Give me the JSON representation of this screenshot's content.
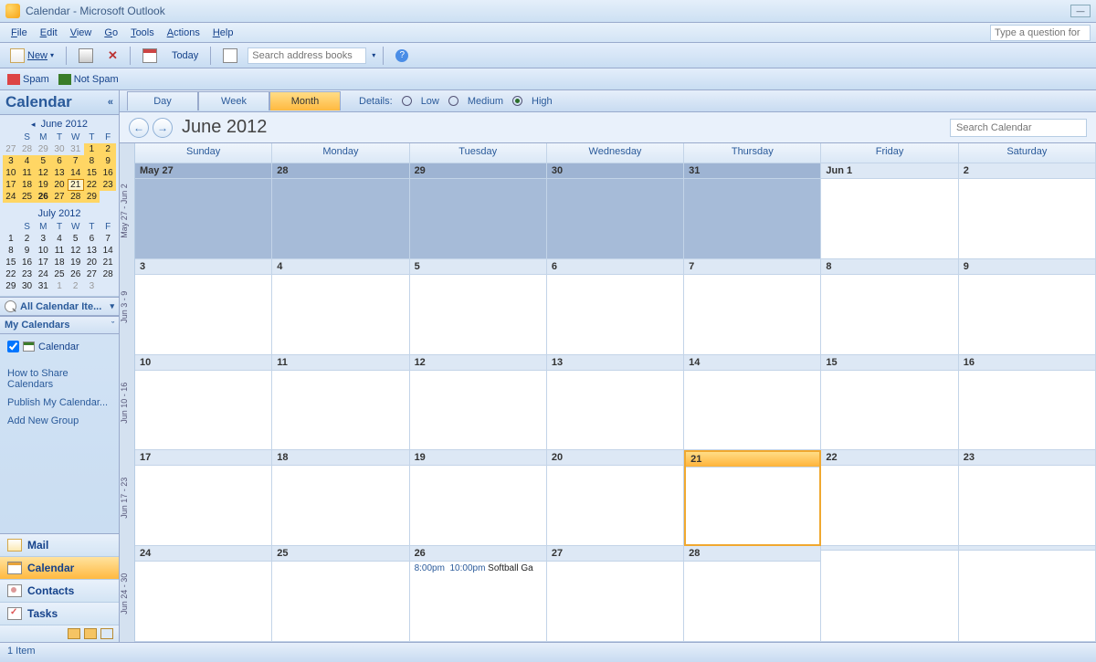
{
  "titlebar": {
    "title": "Calendar - Microsoft Outlook"
  },
  "menu": [
    "File",
    "Edit",
    "View",
    "Go",
    "Tools",
    "Actions",
    "Help"
  ],
  "help_placeholder": "Type a question for",
  "toolbar": {
    "new": "New",
    "today": "Today",
    "search_placeholder": "Search address books"
  },
  "spam": {
    "spam": "Spam",
    "notspam": "Not Spam"
  },
  "leftnav": {
    "header": "Calendar",
    "month1": {
      "title": "June 2012",
      "dow": [
        "S",
        "M",
        "T",
        "W",
        "T",
        "F"
      ],
      "weeks": [
        [
          {
            "n": "27",
            "c": "off"
          },
          {
            "n": "28",
            "c": "off"
          },
          {
            "n": "29",
            "c": "off"
          },
          {
            "n": "30",
            "c": "off"
          },
          {
            "n": "31",
            "c": "off"
          },
          {
            "n": "1",
            "c": "cur"
          },
          {
            "n": "2",
            "c": "cur"
          }
        ],
        [
          {
            "n": "3",
            "c": "cur"
          },
          {
            "n": "4",
            "c": "cur"
          },
          {
            "n": "5",
            "c": "cur"
          },
          {
            "n": "6",
            "c": "cur"
          },
          {
            "n": "7",
            "c": "cur"
          },
          {
            "n": "8",
            "c": "cur"
          },
          {
            "n": "9",
            "c": "cur"
          }
        ],
        [
          {
            "n": "10",
            "c": "cur"
          },
          {
            "n": "11",
            "c": "cur"
          },
          {
            "n": "12",
            "c": "cur"
          },
          {
            "n": "13",
            "c": "cur"
          },
          {
            "n": "14",
            "c": "cur"
          },
          {
            "n": "15",
            "c": "cur"
          },
          {
            "n": "16",
            "c": "cur"
          }
        ],
        [
          {
            "n": "17",
            "c": "cur"
          },
          {
            "n": "18",
            "c": "cur"
          },
          {
            "n": "19",
            "c": "cur"
          },
          {
            "n": "20",
            "c": "cur"
          },
          {
            "n": "21",
            "c": "cur today"
          },
          {
            "n": "22",
            "c": "cur"
          },
          {
            "n": "23",
            "c": "cur"
          }
        ],
        [
          {
            "n": "24",
            "c": "cur"
          },
          {
            "n": "25",
            "c": "cur"
          },
          {
            "n": "26",
            "c": "cur bold"
          },
          {
            "n": "27",
            "c": "cur"
          },
          {
            "n": "28",
            "c": "cur"
          },
          {
            "n": "29",
            "c": "cur"
          },
          {
            "n": ""
          }
        ]
      ]
    },
    "month2": {
      "title": "July 2012",
      "dow": [
        "S",
        "M",
        "T",
        "W",
        "T",
        "F"
      ],
      "weeks": [
        [
          {
            "n": "1"
          },
          {
            "n": "2"
          },
          {
            "n": "3"
          },
          {
            "n": "4"
          },
          {
            "n": "5"
          },
          {
            "n": "6"
          },
          {
            "n": "7"
          }
        ],
        [
          {
            "n": "8"
          },
          {
            "n": "9"
          },
          {
            "n": "10"
          },
          {
            "n": "11"
          },
          {
            "n": "12"
          },
          {
            "n": "13"
          },
          {
            "n": "14"
          }
        ],
        [
          {
            "n": "15"
          },
          {
            "n": "16"
          },
          {
            "n": "17"
          },
          {
            "n": "18"
          },
          {
            "n": "19"
          },
          {
            "n": "20"
          },
          {
            "n": "21"
          }
        ],
        [
          {
            "n": "22"
          },
          {
            "n": "23"
          },
          {
            "n": "24"
          },
          {
            "n": "25"
          },
          {
            "n": "26"
          },
          {
            "n": "27"
          },
          {
            "n": "28"
          }
        ],
        [
          {
            "n": "29"
          },
          {
            "n": "30"
          },
          {
            "n": "31"
          },
          {
            "n": "1",
            "c": "off"
          },
          {
            "n": "2",
            "c": "off"
          },
          {
            "n": "3",
            "c": "off"
          },
          {
            "n": ""
          }
        ]
      ]
    },
    "allitems": "All Calendar Ite...",
    "mycal_head": "My Calendars",
    "mycal_item": "Calendar",
    "links": [
      "How to Share Calendars",
      "Publish My Calendar...",
      "Add New Group"
    ],
    "navbtns": [
      "Mail",
      "Calendar",
      "Contacts",
      "Tasks"
    ]
  },
  "viewtabs": {
    "day": "Day",
    "week": "Week",
    "month": "Month",
    "details": "Details:",
    "low": "Low",
    "medium": "Medium",
    "high": "High"
  },
  "header": {
    "title": "June 2012",
    "search_placeholder": "Search Calendar"
  },
  "grid": {
    "weekhead": [
      "Sunday",
      "Monday",
      "Tuesday",
      "Wednesday",
      "Thursday",
      "Friday",
      "Saturday"
    ],
    "weeklabels": [
      "May 27 - Jun 2",
      "Jun 3 - 9",
      "Jun 10 - 16",
      "Jun 17 - 23",
      "Jun 24 - 30"
    ],
    "weeks": [
      [
        {
          "n": "May 27",
          "prev": true
        },
        {
          "n": "28",
          "prev": true
        },
        {
          "n": "29",
          "prev": true
        },
        {
          "n": "30",
          "prev": true
        },
        {
          "n": "31",
          "prev": true
        },
        {
          "n": "Jun 1"
        },
        {
          "n": "2"
        }
      ],
      [
        {
          "n": "3"
        },
        {
          "n": "4"
        },
        {
          "n": "5"
        },
        {
          "n": "6"
        },
        {
          "n": "7"
        },
        {
          "n": "8"
        },
        {
          "n": "9"
        }
      ],
      [
        {
          "n": "10"
        },
        {
          "n": "11"
        },
        {
          "n": "12"
        },
        {
          "n": "13"
        },
        {
          "n": "14"
        },
        {
          "n": "15"
        },
        {
          "n": "16"
        }
      ],
      [
        {
          "n": "17"
        },
        {
          "n": "18"
        },
        {
          "n": "19"
        },
        {
          "n": "20"
        },
        {
          "n": "21",
          "today": true
        },
        {
          "n": "22"
        },
        {
          "n": "23"
        }
      ],
      [
        {
          "n": "24"
        },
        {
          "n": "25"
        },
        {
          "n": "26",
          "event": {
            "t1": "8:00pm",
            "t2": "10:00pm",
            "txt": "Softball Ga"
          }
        },
        {
          "n": "27"
        },
        {
          "n": "28"
        },
        {
          "n": ""
        },
        {
          "n": ""
        }
      ]
    ]
  },
  "status": "1 Item"
}
